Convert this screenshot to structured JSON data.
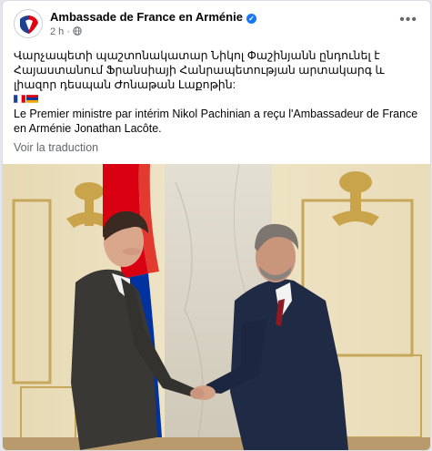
{
  "post": {
    "page_name": "Ambassade de France en Arménie",
    "timestamp": "2 h",
    "separator": "·",
    "text_hy": "Վարչապետի պաշտոնակատար Նիկոլ Փաշինյանն ընդունել է Հայաստանում Ֆրանսիայի Հանրապետության արտակարգ և լիազոր դեսպան Ժոնաթան Լաքոթին:",
    "text_fr": "Le Premier ministre par intérim Nikol Pachinian a reçu l'Ambassadeur de France en Arménie Jonathan Lacôte.",
    "see_translation": "Voir la traduction",
    "more_label": "•••"
  },
  "icons": {
    "verified": "verified-badge-icon",
    "globe": "globe-icon",
    "more": "more-options-icon",
    "flag_fr": "france-flag-icon",
    "flag_am": "armenia-flag-icon"
  },
  "colors": {
    "brand_blue": "#1877f2",
    "text_primary": "#050505",
    "text_secondary": "#65676b"
  }
}
